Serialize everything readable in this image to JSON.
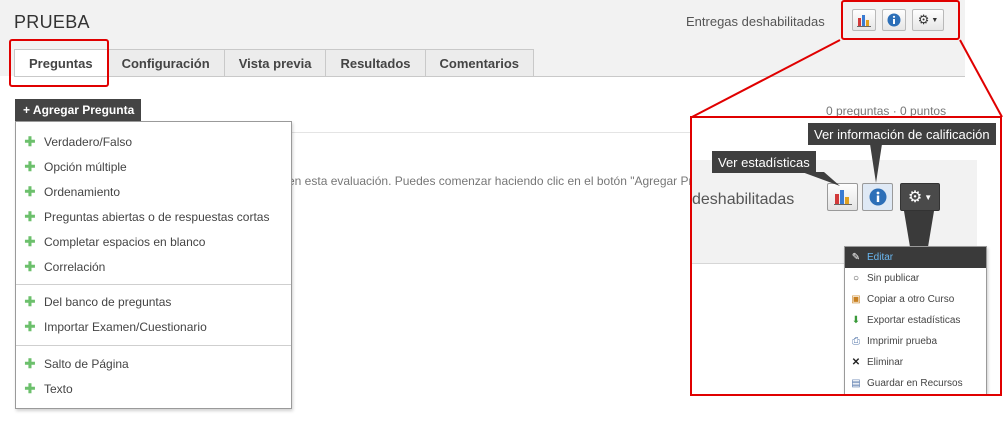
{
  "app": {
    "title": "PRUEBA"
  },
  "header": {
    "status": "Entregas deshabilitadas",
    "stats_icon": "bar-chart-icon",
    "info_icon": "info-icon",
    "settings_icon": "gear-icon"
  },
  "tabs": [
    {
      "label": "Preguntas",
      "active": true
    },
    {
      "label": "Configuración"
    },
    {
      "label": "Vista previa"
    },
    {
      "label": "Resultados"
    },
    {
      "label": "Comentarios"
    }
  ],
  "toolbar": {
    "add_label": "+ Agregar Pregunta",
    "counts": "0 preguntas · 0 puntos"
  },
  "main": {
    "empty_text": "en esta evaluación. Puedes comenzar haciendo clic en el botón \"Agregar Pre"
  },
  "add_menu": {
    "group1": [
      "Verdadero/Falso",
      "Opción múltiple",
      "Ordenamiento",
      "Preguntas abiertas o de respuestas cortas",
      "Completar espacios en blanco",
      "Correlación"
    ],
    "group2": [
      "Del banco de preguntas",
      "Importar Examen/Cuestionario"
    ],
    "group3": [
      "Salto de Página",
      "Texto"
    ]
  },
  "zoom": {
    "status_fragment": "deshabilitadas",
    "tooltip_info": "Ver información de calificación",
    "tooltip_stats": "Ver estadísticas",
    "settings_menu": [
      {
        "label": "Editar",
        "icon": "pencil-icon"
      },
      {
        "label": "Sin publicar",
        "icon": "circle-icon"
      },
      {
        "label": "Copiar a otro Curso",
        "icon": "copy-icon"
      },
      {
        "label": "Exportar estadísticas",
        "icon": "download-icon"
      },
      {
        "label": "Imprimir prueba",
        "icon": "printer-icon"
      },
      {
        "label": "Eliminar",
        "icon": "close-icon"
      },
      {
        "label": "Guardar en Recursos",
        "icon": "save-resources-icon"
      }
    ]
  },
  "colors": {
    "highlight": "#e00000",
    "add_button_bg": "#444444",
    "plus_green": "#6cc06c",
    "info_blue": "#2c6fb8"
  }
}
